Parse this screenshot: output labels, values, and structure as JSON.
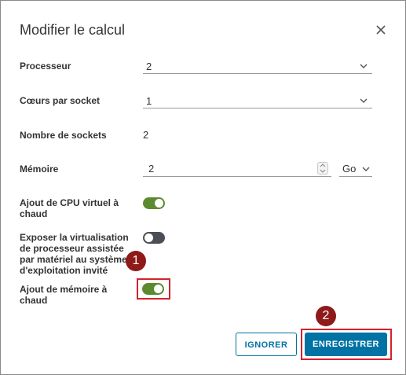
{
  "dialog": {
    "title": "Modifier le calcul"
  },
  "fields": {
    "processor": {
      "label": "Processeur",
      "value": "2"
    },
    "cores_per_socket": {
      "label": "Cœurs par socket",
      "value": "1"
    },
    "sockets": {
      "label": "Nombre de sockets",
      "value": "2"
    },
    "memory": {
      "label": "Mémoire",
      "value": "2",
      "unit": "Go"
    },
    "cpu_hot_add": {
      "label": "Ajout de CPU virtuel à chaud",
      "enabled": true
    },
    "hw_virtualization": {
      "label": "Exposer la virtualisation de processeur assistée par matériel au système d'exploitation invité",
      "enabled": false
    },
    "memory_hot_add": {
      "label": "Ajout de mémoire à chaud",
      "enabled": true
    }
  },
  "annotations": {
    "badge_1": "1",
    "badge_2": "2"
  },
  "buttons": {
    "cancel": "IGNORER",
    "save": "ENREGISTRER"
  },
  "colors": {
    "accent": "#0072a3",
    "toggle_on": "#5b8b2e",
    "toggle_off": "#4a4f55",
    "highlight": "#d3232c",
    "badge": "#8e1a1a"
  },
  "icons": [
    "close-icon",
    "chevron-down-icon",
    "spinner-icon"
  ]
}
